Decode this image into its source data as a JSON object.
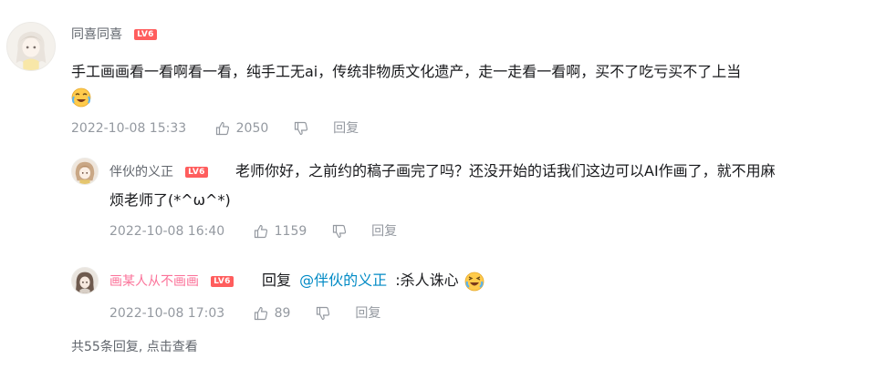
{
  "comment": {
    "username": "同喜同喜",
    "level_badge": "LV6",
    "text": "手工画画看一看啊看一看，纯手工无ai，传统非物质文化遗产，走一走看一看啊，买不了吃亏买不了上当",
    "emoji_icon": "crying-laugh-emoji",
    "timestamp": "2022-10-08 15:33",
    "likes": "2050",
    "reply_label": "回复"
  },
  "replies": [
    {
      "username": "伴伙的义正",
      "level_badge": "LV6",
      "text_line1": "老师你好，之前约的稿子画完了吗？还没开始的话我们这边可以AI作画了，就不用麻",
      "text_line2": "烦老师了(*^ω^*)",
      "timestamp": "2022-10-08 16:40",
      "likes": "1159",
      "reply_label": "回复"
    },
    {
      "username": "画某人从不画画",
      "level_badge": "LV6",
      "reply_prefix": "回复",
      "mention": "@伴伙的义正",
      "text": ":杀人诛心",
      "emoji_icon": "laughing-tears-emoji",
      "timestamp": "2022-10-08 17:03",
      "likes": "89",
      "reply_label": "回复"
    }
  ],
  "footer": {
    "summary": "共55条回复, 点击查看"
  },
  "colors": {
    "username_pink": "#fb7299",
    "level_badge": "#ff5d5d",
    "mention_link": "#008ac5",
    "meta_gray": "#9499a0"
  }
}
